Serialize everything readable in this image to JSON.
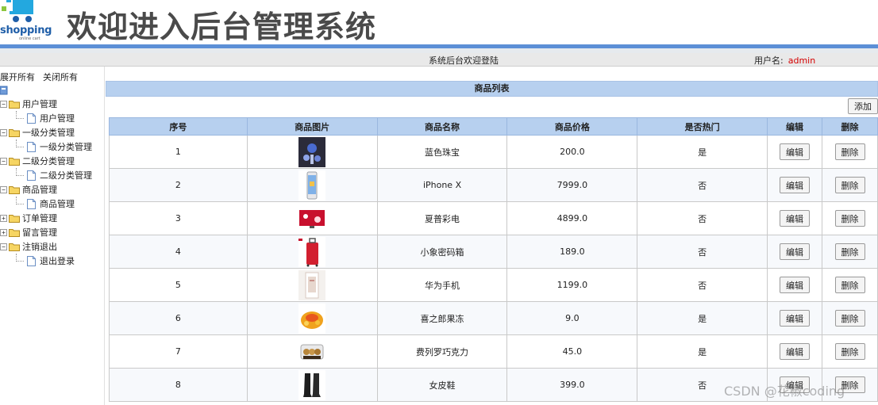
{
  "header": {
    "logo_word": "shopping",
    "logo_sub": "online cart",
    "site_title": "欢迎进入后台管理系统"
  },
  "infobar": {
    "welcome": "系统后台欢迎登陆",
    "user_label": "用户名:",
    "username": "admin"
  },
  "sidebar": {
    "expand_all": "展开所有",
    "collapse_all": "关闭所有",
    "groups": [
      {
        "label": "用户管理",
        "expanded": true,
        "children": [
          "用户管理"
        ]
      },
      {
        "label": "一级分类管理",
        "expanded": true,
        "children": [
          "一级分类管理"
        ]
      },
      {
        "label": "二级分类管理",
        "expanded": true,
        "children": [
          "二级分类管理"
        ]
      },
      {
        "label": "商品管理",
        "expanded": true,
        "children": [
          "商品管理"
        ]
      },
      {
        "label": "订单管理",
        "expanded": false,
        "children": []
      },
      {
        "label": "留言管理",
        "expanded": false,
        "children": []
      },
      {
        "label": "注销退出",
        "expanded": true,
        "children": [
          "退出登录"
        ]
      }
    ]
  },
  "main": {
    "list_title": "商品列表",
    "add_label": "添加",
    "columns": [
      "序号",
      "商品图片",
      "商品名称",
      "商品价格",
      "是否热门",
      "编辑",
      "删除"
    ],
    "edit_label": "编辑",
    "delete_label": "删除",
    "rows": [
      {
        "index": "1",
        "image": "jewelry-photo",
        "name": "蓝色珠宝",
        "price": "200.0",
        "hot": "是"
      },
      {
        "index": "2",
        "image": "phone-photo",
        "name": "iPhone X",
        "price": "7999.0",
        "hot": "否"
      },
      {
        "index": "3",
        "image": "tv-photo",
        "name": "夏普彩电",
        "price": "4899.0",
        "hot": "否"
      },
      {
        "index": "4",
        "image": "suitcase-photo",
        "name": "小象密码箱",
        "price": "189.0",
        "hot": "否"
      },
      {
        "index": "5",
        "image": "phone-box-photo",
        "name": "华为手机",
        "price": "1199.0",
        "hot": "否"
      },
      {
        "index": "6",
        "image": "jelly-photo",
        "name": "喜之郎果冻",
        "price": "9.0",
        "hot": "是"
      },
      {
        "index": "7",
        "image": "chocolate-photo",
        "name": "费列罗巧克力",
        "price": "45.0",
        "hot": "是"
      },
      {
        "index": "8",
        "image": "boots-photo",
        "name": "女皮鞋",
        "price": "399.0",
        "hot": "否"
      }
    ]
  },
  "watermark": "CSDN @花椒coding"
}
